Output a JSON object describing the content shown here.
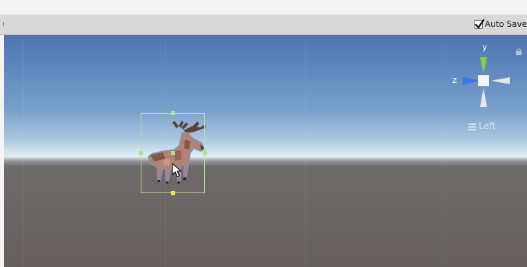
{
  "toolbar": {
    "autosave": {
      "label": "Auto Save",
      "checked": true,
      "checkbox_icon": "checkmark-icon"
    }
  },
  "scene_view": {
    "orientation_gizmo": {
      "y_label": "y",
      "z_label": "z",
      "axis_colors": {
        "y": "#8ad13b",
        "z": "#3c78e8",
        "x": "#e0e0e0"
      },
      "lock_icon": "lock-icon"
    },
    "view_label": "Left",
    "view_label_icon": "menu-icon",
    "selected_object": "moose",
    "selection_color": "#b7e38f",
    "pivot_color": "#f3e04a"
  }
}
